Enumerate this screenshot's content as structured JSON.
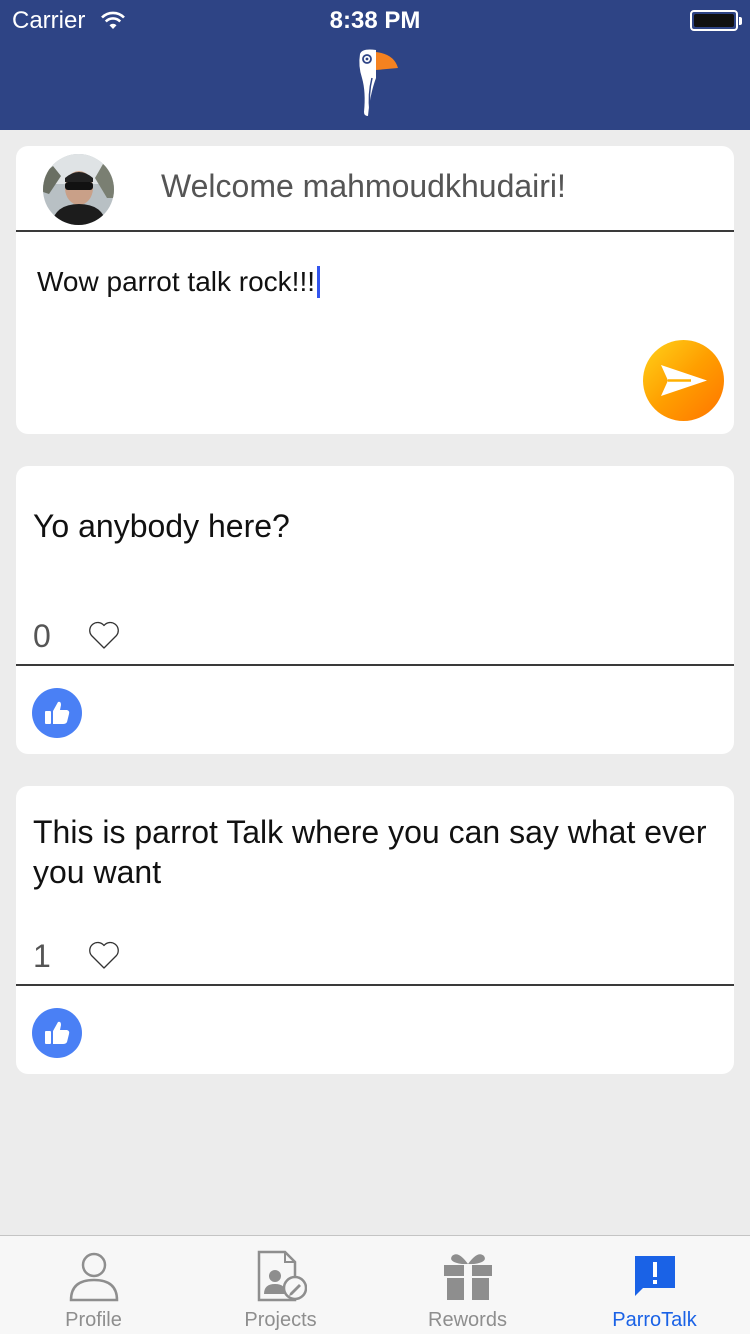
{
  "status_bar": {
    "carrier": "Carrier",
    "time": "8:38 PM"
  },
  "compose": {
    "welcome": "Welcome mahmoudkhudairi!",
    "text": "Wow parrot talk rock!!!"
  },
  "posts": [
    {
      "text": "Yo anybody here?",
      "likes": "0"
    },
    {
      "text": "This is parrot Talk where you can say what ever you want",
      "likes": "1"
    }
  ],
  "tabbar": {
    "tabs": [
      {
        "label": "Profile",
        "icon": "person-icon"
      },
      {
        "label": "Projects",
        "icon": "projects-icon"
      },
      {
        "label": "Rewords",
        "icon": "gift-icon"
      },
      {
        "label": "ParroTalk",
        "icon": "alert-bubble-icon"
      }
    ],
    "active": "ParroTalk"
  },
  "colors": {
    "header": "#2e4485",
    "send_gradient_start": "#ffd21a",
    "send_gradient_end": "#ff7400",
    "thumb_button": "#4a80f5",
    "tab_active": "#1a62e6",
    "tab_inactive": "#8e8e8e"
  }
}
